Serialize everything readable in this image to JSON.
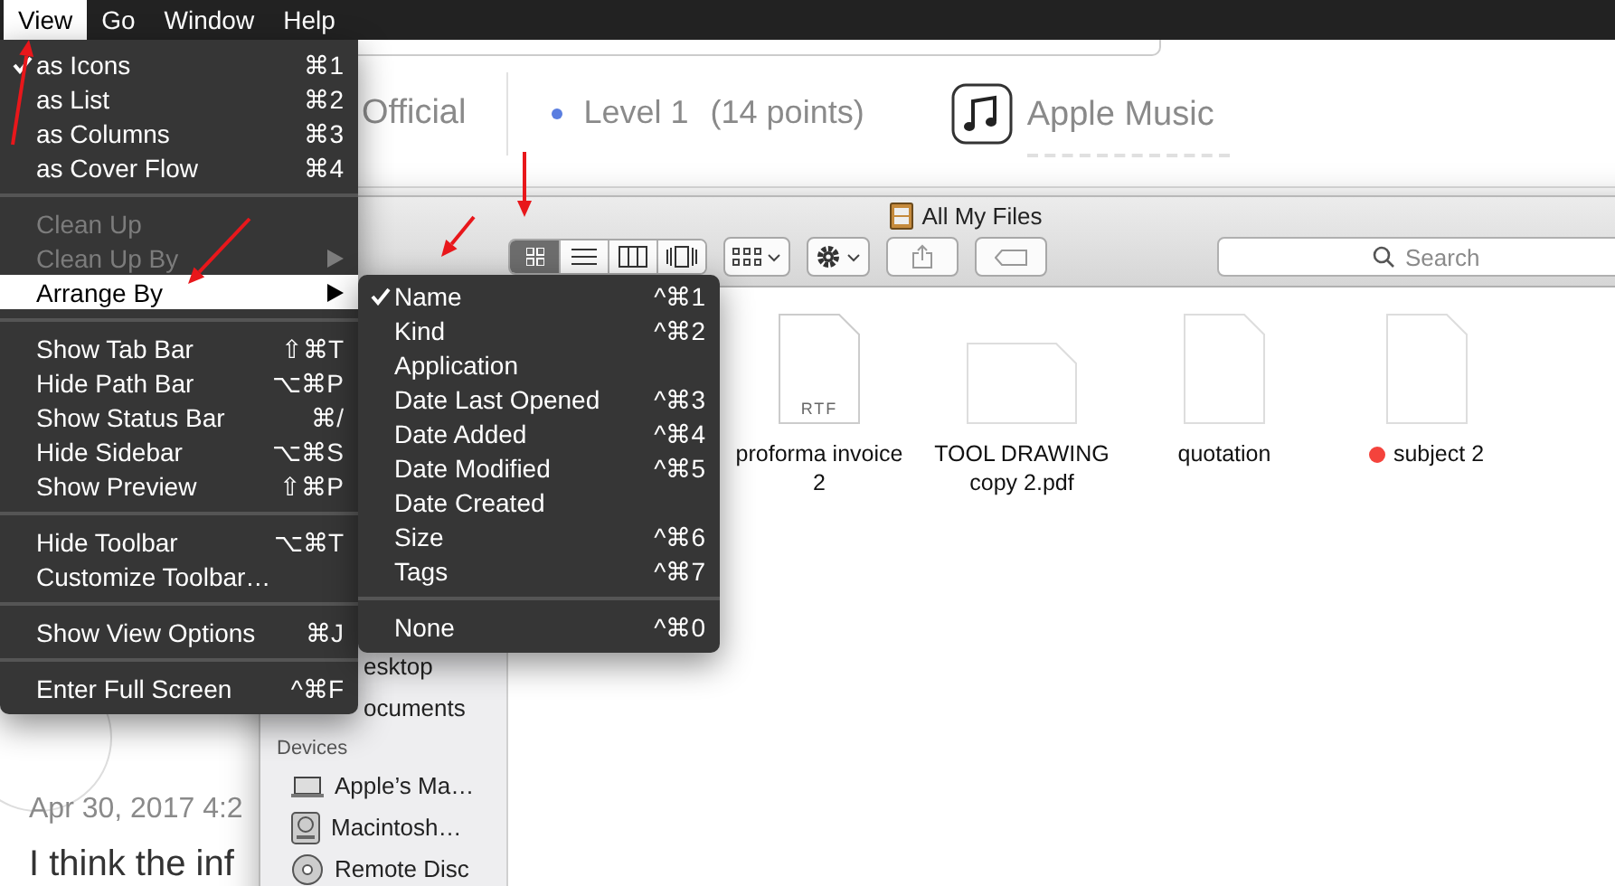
{
  "menu_bar": {
    "items": [
      {
        "label": "View",
        "selected": true
      },
      {
        "label": "Go",
        "selected": false
      },
      {
        "label": "Window",
        "selected": false
      },
      {
        "label": "Help",
        "selected": false
      }
    ]
  },
  "web_page": {
    "official": "Official",
    "level": "Level 1",
    "points": "(14 points)",
    "app_name": "Apple Music",
    "date": "Apr 30, 2017 4:2",
    "body": "I think the inf"
  },
  "finder": {
    "title": "All My Files",
    "view_buttons": [
      {
        "kind": "icons",
        "selected": true
      },
      {
        "kind": "list",
        "selected": false
      },
      {
        "kind": "columns",
        "selected": false
      },
      {
        "kind": "coverflow",
        "selected": false
      }
    ],
    "search": {
      "placeholder": "Search"
    },
    "sidebar": {
      "items": [
        {
          "label": "esktop"
        },
        {
          "label": "ocuments"
        }
      ],
      "sections": [
        {
          "heading": "Devices",
          "items": [
            {
              "label": "Apple’s Ma…",
              "kind": "laptop"
            },
            {
              "label": "Macintosh…",
              "kind": "disk"
            },
            {
              "label": "Remote Disc",
              "kind": "disc"
            }
          ]
        }
      ]
    },
    "files": [
      {
        "name": "proforma invoice 2",
        "kind": "rtf",
        "badge": "RTF"
      },
      {
        "name": "TOOL DRAWING copy 2.pdf",
        "kind": "landscape"
      },
      {
        "name": "quotation",
        "kind": "document"
      },
      {
        "name": "subject 2",
        "kind": "document",
        "color": "#f4433c"
      }
    ]
  },
  "view_menu": {
    "items": [
      {
        "kind": "item",
        "label": "as Icons",
        "shortcut": "⌘1",
        "checked": true,
        "disabled": false,
        "selected": false,
        "submenu": false
      },
      {
        "kind": "item",
        "label": "as List",
        "shortcut": "⌘2",
        "checked": false,
        "disabled": false,
        "selected": false,
        "submenu": false
      },
      {
        "kind": "item",
        "label": "as Columns",
        "shortcut": "⌘3",
        "checked": false,
        "disabled": false,
        "selected": false,
        "submenu": false
      },
      {
        "kind": "item",
        "label": "as Cover Flow",
        "shortcut": "⌘4",
        "checked": false,
        "disabled": false,
        "selected": false,
        "submenu": false
      },
      {
        "kind": "separator"
      },
      {
        "kind": "item",
        "label": "Clean Up",
        "checked": false,
        "disabled": true,
        "selected": false,
        "submenu": false
      },
      {
        "kind": "item",
        "label": "Clean Up By",
        "checked": false,
        "disabled": true,
        "selected": false,
        "submenu": true
      },
      {
        "kind": "item",
        "label": "Arrange By",
        "checked": false,
        "disabled": false,
        "selected": true,
        "submenu": true
      },
      {
        "kind": "separator"
      },
      {
        "kind": "item",
        "label": "Show Tab Bar",
        "shortcut": "⇧⌘T",
        "checked": false,
        "disabled": false,
        "selected": false,
        "submenu": false
      },
      {
        "kind": "item",
        "label": "Hide Path Bar",
        "shortcut": "⌥⌘P",
        "checked": false,
        "disabled": false,
        "selected": false,
        "submenu": false
      },
      {
        "kind": "item",
        "label": "Show Status Bar",
        "shortcut": "⌘/",
        "checked": false,
        "disabled": false,
        "selected": false,
        "submenu": false
      },
      {
        "kind": "item",
        "label": "Hide Sidebar",
        "shortcut": "⌥⌘S",
        "checked": false,
        "disabled": false,
        "selected": false,
        "submenu": false
      },
      {
        "kind": "item",
        "label": "Show Preview",
        "shortcut": "⇧⌘P",
        "checked": false,
        "disabled": false,
        "selected": false,
        "submenu": false
      },
      {
        "kind": "separator"
      },
      {
        "kind": "item",
        "label": "Hide Toolbar",
        "shortcut": "⌥⌘T",
        "checked": false,
        "disabled": false,
        "selected": false,
        "submenu": false
      },
      {
        "kind": "item",
        "label": "Customize Toolbar…",
        "checked": false,
        "disabled": false,
        "selected": false,
        "submenu": false
      },
      {
        "kind": "separator"
      },
      {
        "kind": "item",
        "label": "Show View Options",
        "shortcut": "⌘J",
        "checked": false,
        "disabled": false,
        "selected": false,
        "submenu": false
      },
      {
        "kind": "separator"
      },
      {
        "kind": "item",
        "label": "Enter Full Screen",
        "shortcut": "^⌘F",
        "checked": false,
        "disabled": false,
        "selected": false,
        "submenu": false
      }
    ]
  },
  "arrange_menu": {
    "items": [
      {
        "kind": "item",
        "label": "Name",
        "shortcut": "^⌘1",
        "checked": true
      },
      {
        "kind": "item",
        "label": "Kind",
        "shortcut": "^⌘2",
        "checked": false
      },
      {
        "kind": "item",
        "label": "Application",
        "checked": false
      },
      {
        "kind": "item",
        "label": "Date Last Opened",
        "shortcut": "^⌘3",
        "checked": false
      },
      {
        "kind": "item",
        "label": "Date Added",
        "shortcut": "^⌘4",
        "checked": false
      },
      {
        "kind": "item",
        "label": "Date Modified",
        "shortcut": "^⌘5",
        "checked": false
      },
      {
        "kind": "item",
        "label": "Date Created",
        "checked": false
      },
      {
        "kind": "item",
        "label": "Size",
        "shortcut": "^⌘6",
        "checked": false
      },
      {
        "kind": "item",
        "label": "Tags",
        "shortcut": "^⌘7",
        "checked": false
      },
      {
        "kind": "separator"
      },
      {
        "kind": "item",
        "label": "None",
        "shortcut": "^⌘0",
        "checked": false
      }
    ]
  }
}
